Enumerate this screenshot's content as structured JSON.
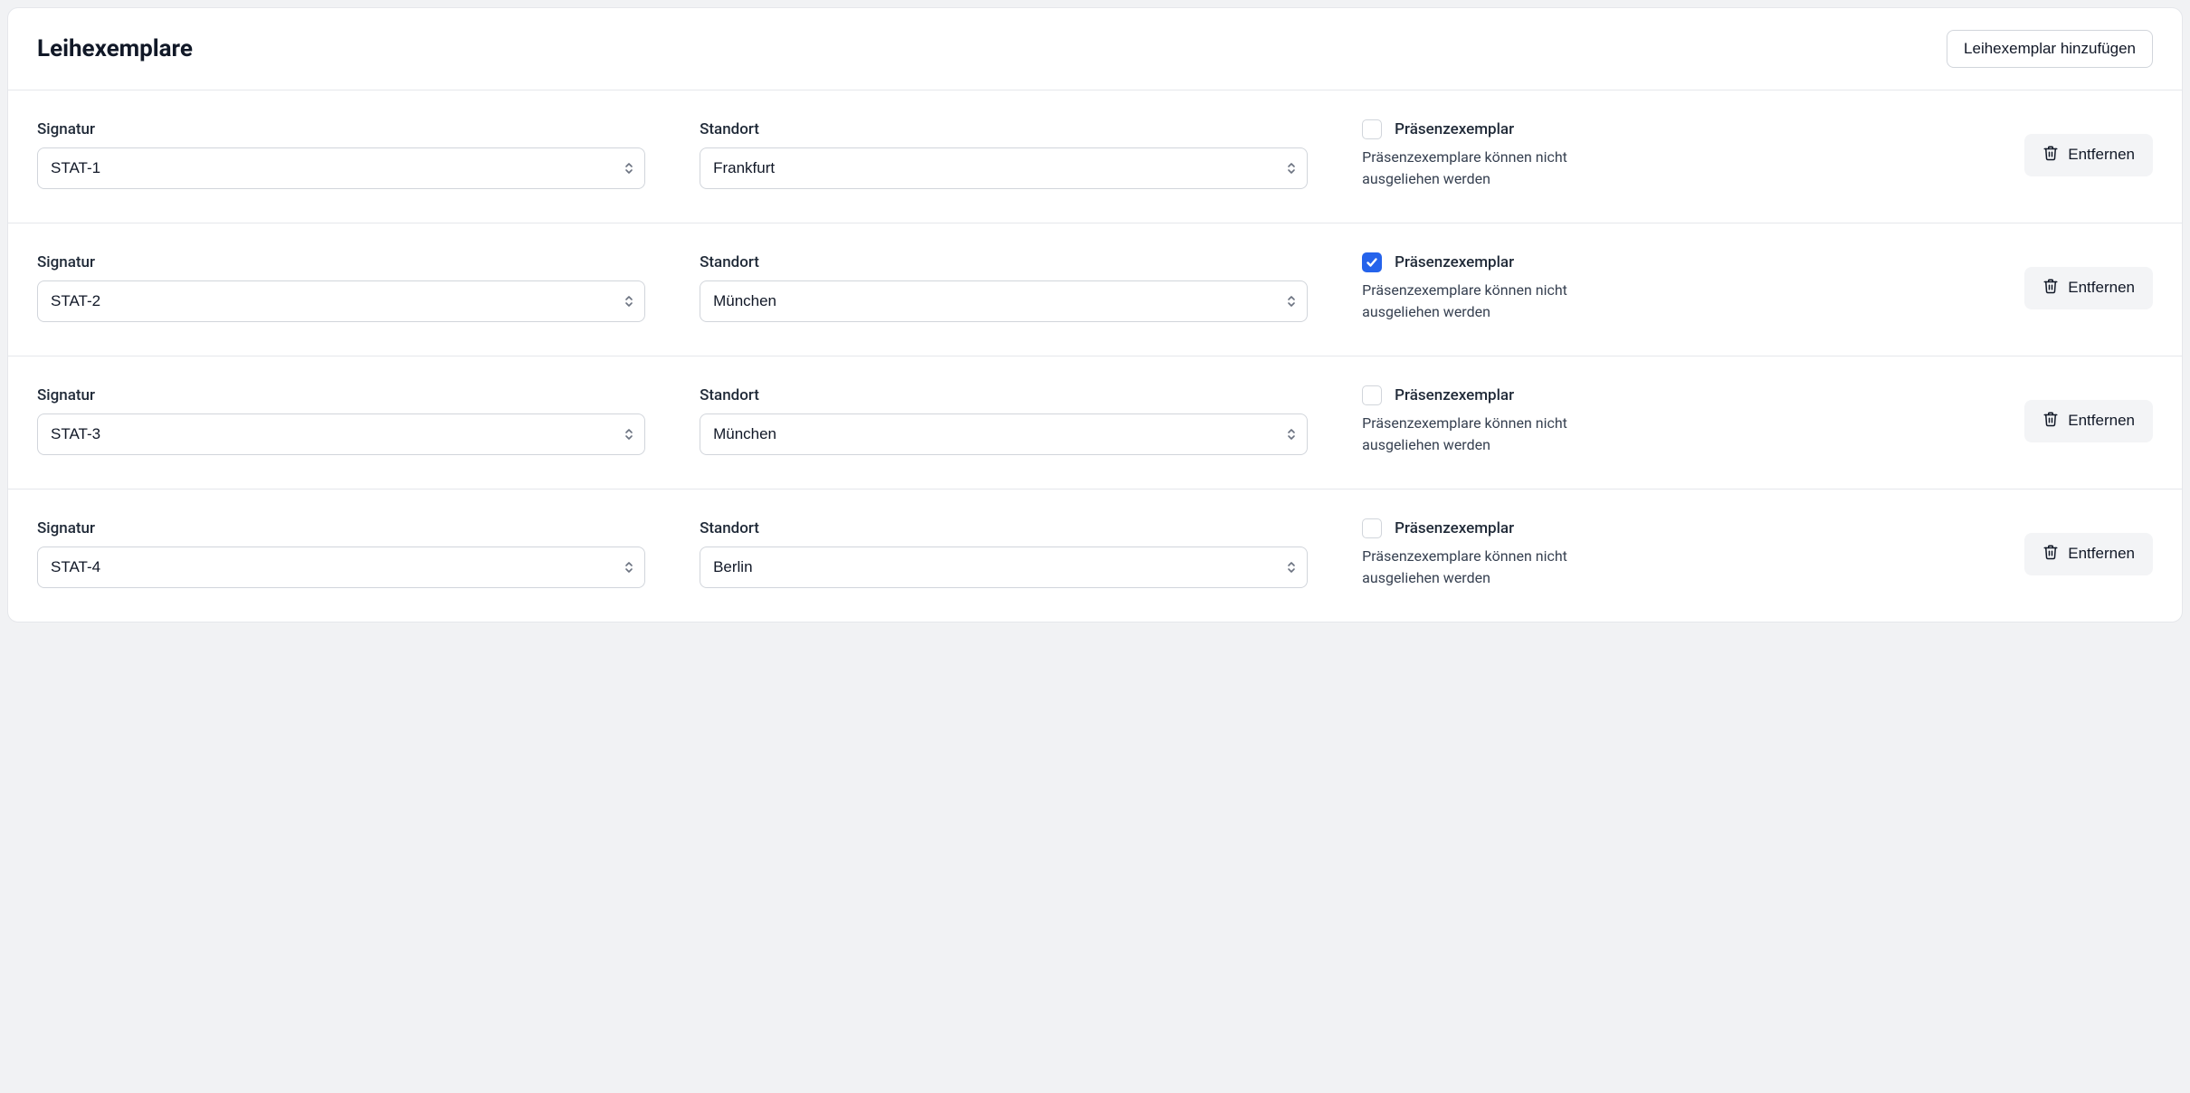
{
  "header": {
    "title": "Leihexemplare",
    "add_label": "Leihexemplar hinzufügen"
  },
  "labels": {
    "signature": "Signatur",
    "location": "Standort",
    "presence": "Präsenzexemplar",
    "presence_hint": "Präsenzexemplare können nicht ausgeliehen werden",
    "remove": "Entfernen"
  },
  "rows": [
    {
      "signature": "STAT-1",
      "location": "Frankfurt",
      "presence": false
    },
    {
      "signature": "STAT-2",
      "location": "München",
      "presence": true
    },
    {
      "signature": "STAT-3",
      "location": "München",
      "presence": false
    },
    {
      "signature": "STAT-4",
      "location": "Berlin",
      "presence": false
    }
  ]
}
